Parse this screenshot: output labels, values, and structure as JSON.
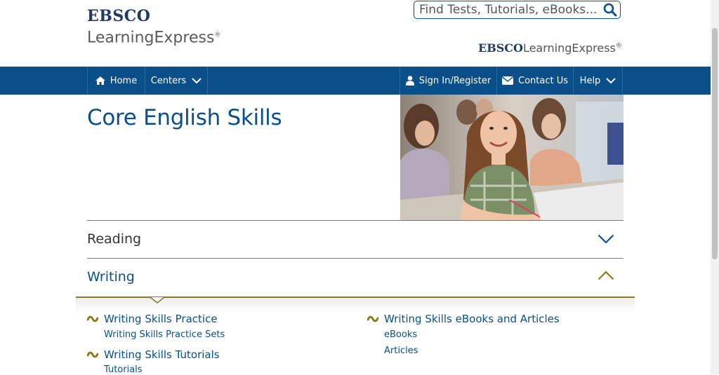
{
  "logo": {
    "top_brand": "EBSCO",
    "top_product": "LearningExpress",
    "reg": "®",
    "right_brand": "EBSCO",
    "right_product": "LearningExpress"
  },
  "search": {
    "placeholder": "Find Tests, Tutorials, eBooks..."
  },
  "nav": {
    "home": "Home",
    "centers": "Centers",
    "sign_in": "Sign In/Register",
    "contact": "Contact Us",
    "help": "Help"
  },
  "page": {
    "title": "Core English Skills"
  },
  "accordion": {
    "reading": "Reading",
    "writing": "Writing"
  },
  "writing_sections": {
    "practice_title": "Writing Skills Practice",
    "practice_sub": "Writing Skills Practice Sets",
    "tutorials_title": "Writing Skills Tutorials",
    "tutorials_sub": "Tutorials",
    "ebooks_title": "Writing Skills eBooks and Articles",
    "ebooks_sub": "eBooks",
    "articles_sub": "Articles"
  },
  "colors": {
    "brand_blue": "#0b4f8a",
    "gold_accent": "#8a7a1e"
  }
}
